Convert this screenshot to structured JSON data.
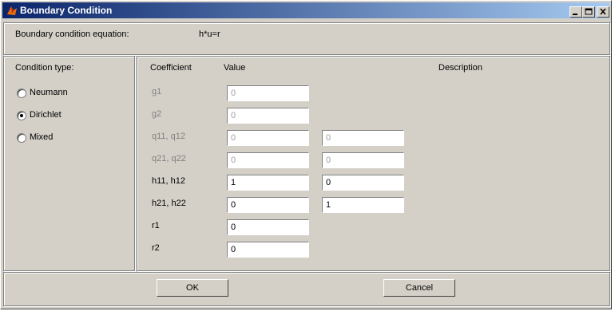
{
  "window": {
    "title": "Boundary Condition"
  },
  "header": {
    "equation_label": "Boundary condition equation:",
    "equation": "h*u=r"
  },
  "condition": {
    "label": "Condition type:",
    "options": [
      {
        "label": "Neumann",
        "selected": false
      },
      {
        "label": "Dirichlet",
        "selected": true
      },
      {
        "label": "Mixed",
        "selected": false
      }
    ]
  },
  "table": {
    "headers": {
      "coefficient": "Coefficient",
      "value": "Value",
      "description": "Description"
    },
    "rows": [
      {
        "name": "g1",
        "enabled": false,
        "values": [
          "0"
        ]
      },
      {
        "name": "g2",
        "enabled": false,
        "values": [
          "0"
        ]
      },
      {
        "name": "q11, q12",
        "enabled": false,
        "values": [
          "0",
          "0"
        ]
      },
      {
        "name": "q21, q22",
        "enabled": false,
        "values": [
          "0",
          "0"
        ]
      },
      {
        "name": "h11, h12",
        "enabled": true,
        "values": [
          "1",
          "0"
        ]
      },
      {
        "name": "h21, h22",
        "enabled": true,
        "values": [
          "0",
          "1"
        ]
      },
      {
        "name": "r1",
        "enabled": true,
        "values": [
          "0"
        ]
      },
      {
        "name": "r2",
        "enabled": true,
        "values": [
          "0"
        ]
      }
    ]
  },
  "buttons": {
    "ok": "OK",
    "cancel": "Cancel"
  }
}
